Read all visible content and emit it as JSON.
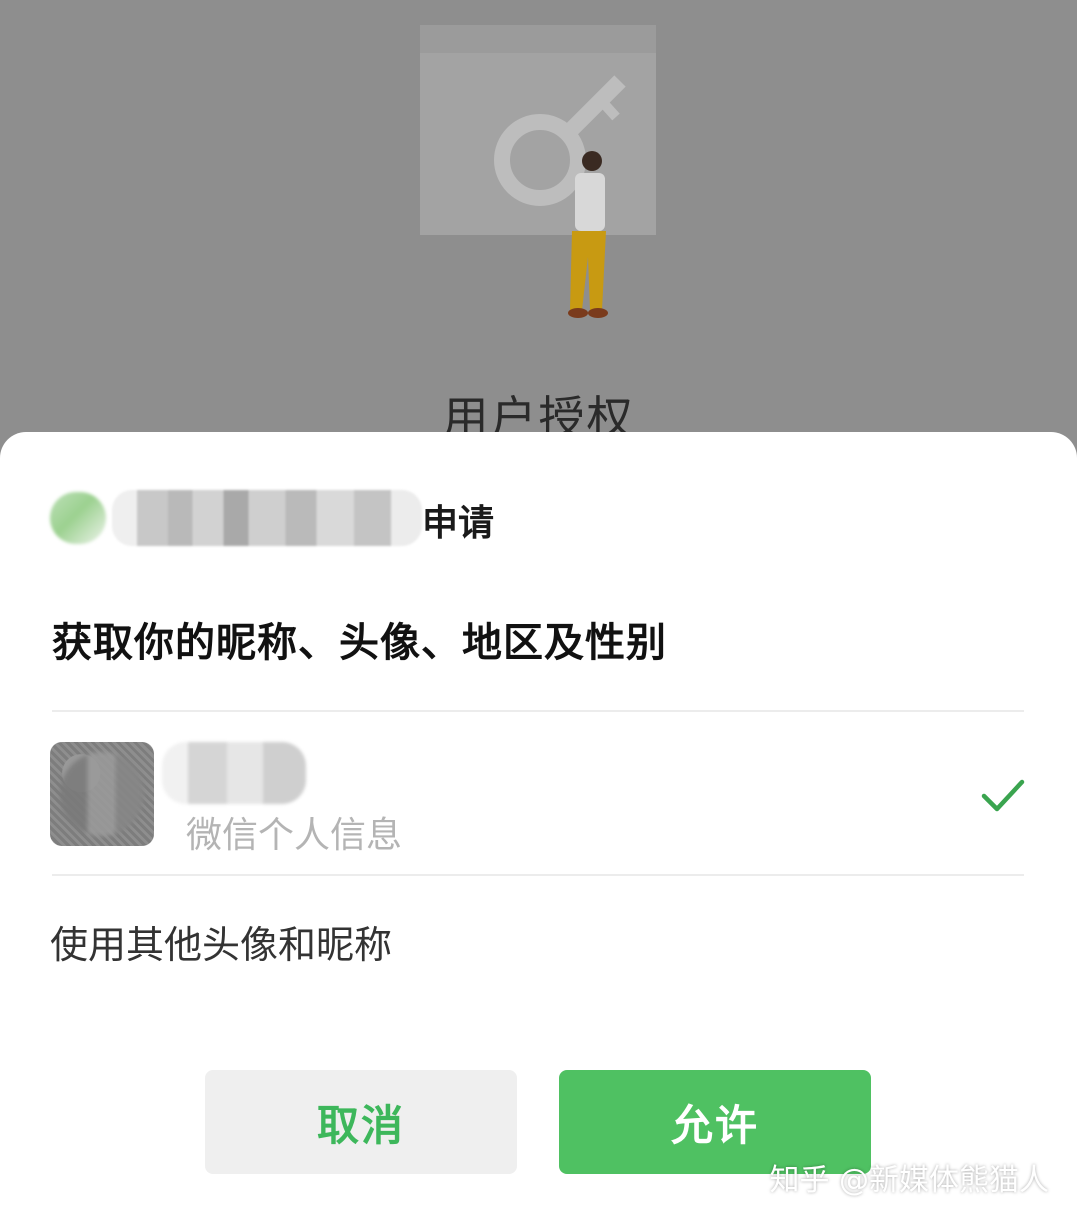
{
  "background": {
    "title": "用户授权"
  },
  "sheet": {
    "request_suffix": "申请",
    "permission_text": "获取你的昵称、头像、地区及性别",
    "profile_option": {
      "sublabel": "微信个人信息",
      "selected": true
    },
    "alternative_option": "使用其他头像和昵称",
    "buttons": {
      "cancel": "取消",
      "allow": "允许"
    }
  },
  "watermark": "知乎 @新媒体熊猫人",
  "colors": {
    "accent": "#4fc162",
    "cancel_text": "#3db75b",
    "overlay": "#8f8f8f"
  }
}
